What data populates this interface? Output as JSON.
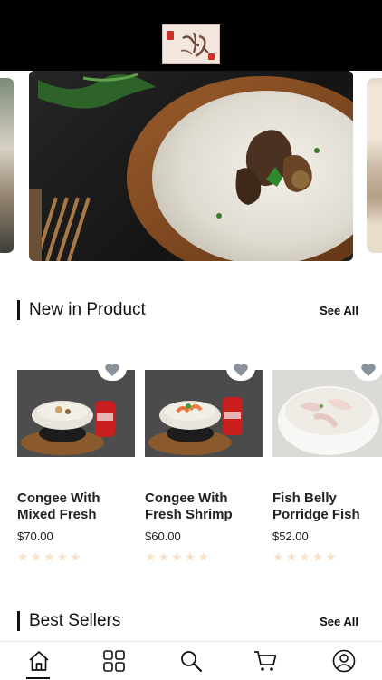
{
  "header": {
    "logo_icon": "porridge-shop-logo"
  },
  "sections": {
    "new_in": {
      "title": "New in Product",
      "see_all": "See All"
    },
    "best_sellers": {
      "title": "Best Sellers",
      "see_all": "See All"
    }
  },
  "products": [
    {
      "name": "Congee With Mixed Fresh",
      "price": "$70.00",
      "rating": 0,
      "rating_max": 5,
      "favorite_icon": "heart-icon"
    },
    {
      "name": "Congee With Fresh Shrimp",
      "price": "$60.00",
      "rating": 0,
      "rating_max": 5,
      "favorite_icon": "heart-icon"
    },
    {
      "name": "Fish Belly Porridge Fish",
      "price": "$52.00",
      "rating": 0,
      "rating_max": 5,
      "favorite_icon": "heart-icon"
    }
  ],
  "bottom_nav": [
    {
      "id": "home",
      "icon": "home-icon",
      "active": true
    },
    {
      "id": "categories",
      "icon": "grid-icon",
      "active": false
    },
    {
      "id": "search",
      "icon": "search-icon",
      "active": false
    },
    {
      "id": "cart",
      "icon": "cart-icon",
      "active": false
    },
    {
      "id": "account",
      "icon": "user-icon",
      "active": false
    }
  ],
  "colors": {
    "header_bg": "#000000",
    "heart": "#8a939c",
    "star_empty": "#f7e1c9",
    "text": "#111111"
  }
}
